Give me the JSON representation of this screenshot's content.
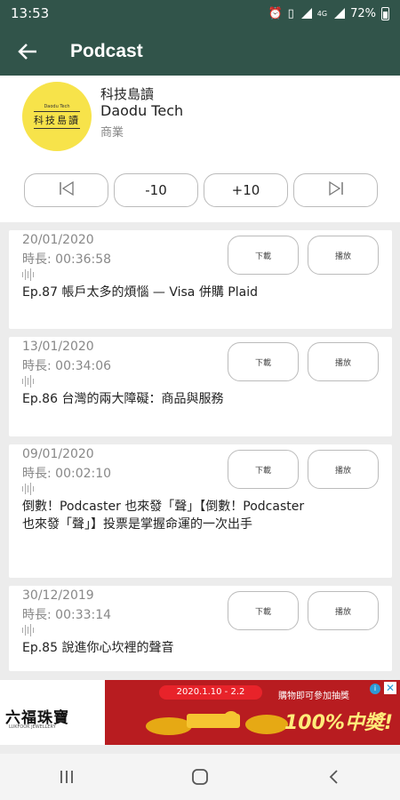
{
  "status_bar": {
    "time": "13:53",
    "icons": [
      "alarm-icon",
      "vibrate-icon",
      "signal-icon",
      "data-icon",
      "signal-icon",
      "battery-icon"
    ],
    "network": "4G",
    "battery": "72%"
  },
  "app_bar": {
    "title": "Podcast",
    "back_icon": "arrow-left-icon"
  },
  "podcast": {
    "logo_small_text": "Daodu Tech",
    "logo_text": "科技島讀",
    "name": "科技島讀",
    "name_en": "Daodu Tech",
    "category": "商業"
  },
  "controls": {
    "prev_icon": "skip-previous-icon",
    "rewind": "-10",
    "forward": "+10",
    "next_icon": "skip-next-icon"
  },
  "episodes": [
    {
      "date": "20/01/2020",
      "duration": "時長: 00:36:58",
      "title": "Ep.87 帳戶太多的煩惱 — Visa 併購 Plaid",
      "download": "下載",
      "play": "播放"
    },
    {
      "date": "13/01/2020",
      "duration": "時長: 00:34:06",
      "title": "Ep.86 台灣的兩大障礙：商品與服務",
      "download": "下載",
      "play": "播放"
    },
    {
      "date": "09/01/2020",
      "duration": "時長: 00:02:10",
      "title": "倒數！Podcaster 也來發「聲」【倒數！Podcaster 也來發「聲」】投票是掌握命運的一次出手",
      "download": "下載",
      "play": "播放"
    },
    {
      "date": "30/12/2019",
      "duration": "時長: 00:33:14",
      "title": "Ep.85 說進你心坎裡的聲音",
      "download": "下載",
      "play": "播放"
    }
  ],
  "ad": {
    "brand": "六福珠寶",
    "brand_en": "LUKFOOK JEWELLERY",
    "date_range": "2020.1.10 - 2.2",
    "promo": "購物即可參加抽獎",
    "headline": "100%中獎!",
    "colors": {
      "background": "#b81c20",
      "headline": "#ffec7a"
    }
  },
  "nav_bar": {
    "icons": [
      "recents-icon",
      "home-icon",
      "back-icon"
    ]
  },
  "colors": {
    "primary": "#31544a",
    "logo": "#f7e34a",
    "background": "#ececec"
  }
}
